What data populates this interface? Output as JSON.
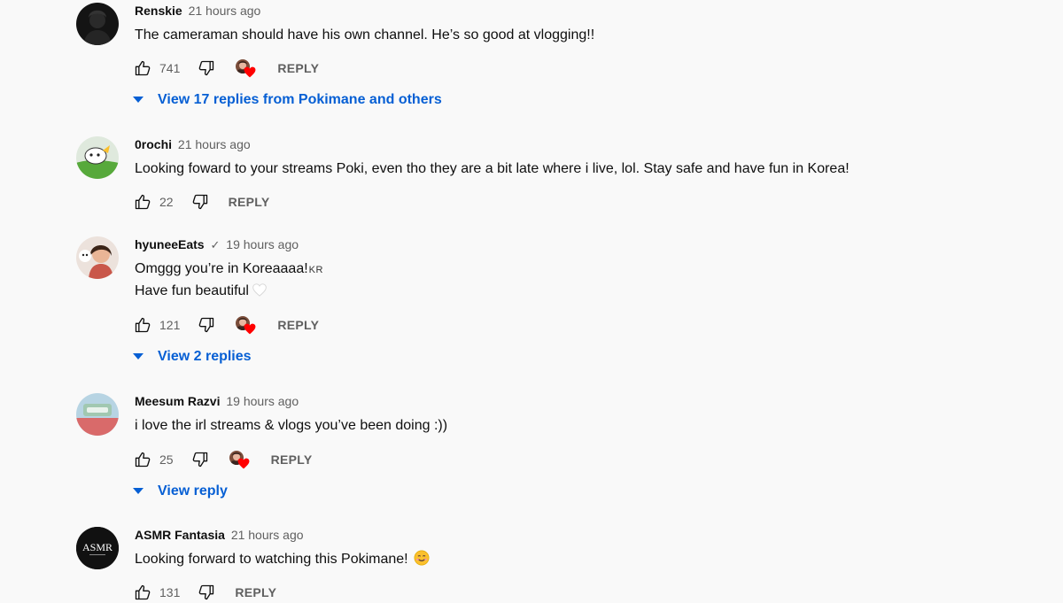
{
  "comments": [
    {
      "author": "Renskie",
      "time": "21 hours ago",
      "text": "The cameraman should have his own channel. He’s so good at vlogging!!",
      "likes": "741",
      "reply_label": "REPLY",
      "replies_label": "View 17 replies from Pokimane and others"
    },
    {
      "author": "0rochi",
      "time": "21 hours ago",
      "text": "Looking foward to your streams Poki, even tho they are a bit late where i live, lol. Stay safe and have fun in Korea!",
      "likes": "22",
      "reply_label": "REPLY"
    },
    {
      "author": "hyuneeEats",
      "verified": "✓",
      "time": "19 hours ago",
      "text_line1": "Omggg you’re in Koreaaaa!",
      "flag": "KR",
      "text_line2": "Have fun beautiful",
      "likes": "121",
      "reply_label": "REPLY",
      "replies_label": "View 2 replies"
    },
    {
      "author": "Meesum Razvi",
      "time": "19 hours ago",
      "text": "i love the irl streams & vlogs you’ve been doing :))",
      "likes": "25",
      "reply_label": "REPLY",
      "replies_label": "View reply"
    },
    {
      "author": "ASMR Fantasia",
      "time": "21 hours ago",
      "avatar_text": "ASMR",
      "text": "Looking forward to watching this Pokimane!",
      "likes": "131",
      "reply_label": "REPLY"
    }
  ],
  "icons": {
    "like": "thumbs-up-icon",
    "dislike": "thumbs-down-icon",
    "creator_heart": "creator-heart-icon",
    "expand": "caret-down-icon"
  },
  "colors": {
    "link": "#065fd4",
    "secondary_text": "#606060",
    "heart": "#ff0000",
    "background": "#f9f9f9"
  }
}
